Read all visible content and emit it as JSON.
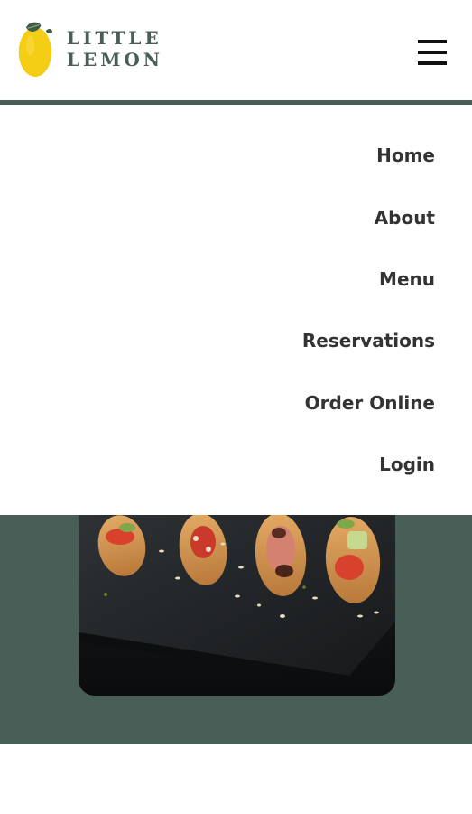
{
  "header": {
    "brand_name": "LITTLE LEMON",
    "logo_icon": "lemon-icon",
    "menu_icon": "hamburger-menu-icon"
  },
  "nav": {
    "items": [
      {
        "label": "Home"
      },
      {
        "label": "About"
      },
      {
        "label": "Menu"
      },
      {
        "label": "Reservations"
      },
      {
        "label": "Order Online"
      },
      {
        "label": "Login"
      }
    ]
  },
  "hero": {
    "image_icon": "food-photo",
    "image_subject": "bruschetta on slate"
  },
  "colors": {
    "primary_green": "#495e57",
    "lemon_yellow": "#f4ce14",
    "nav_text": "#333333"
  }
}
